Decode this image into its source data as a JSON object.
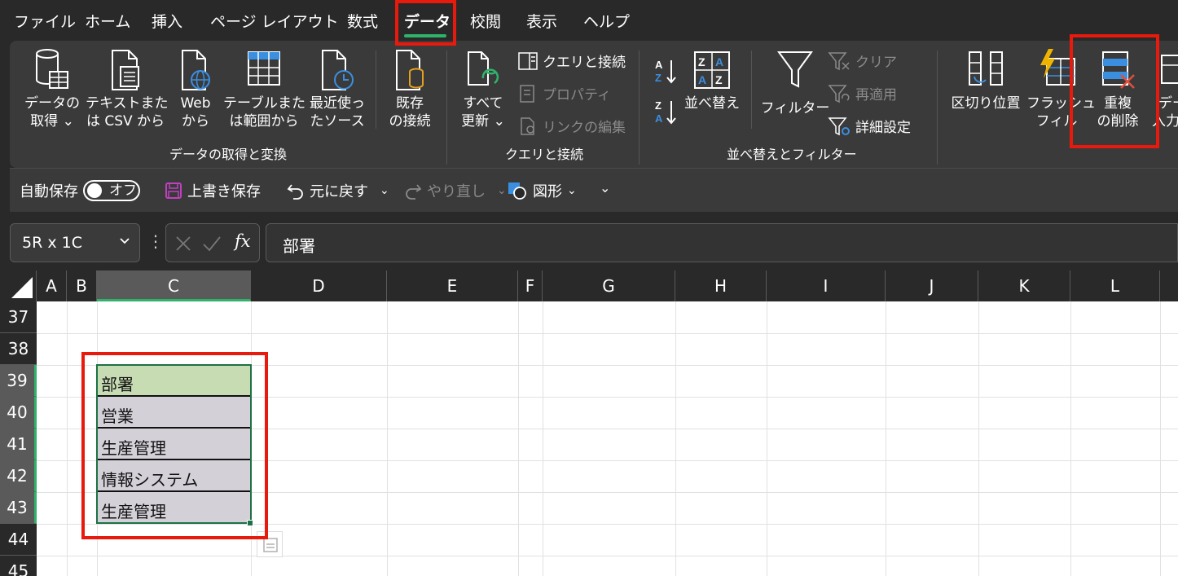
{
  "menu": {
    "tabs": [
      "ファイル",
      "ホーム",
      "挿入",
      "ページ レイアウト",
      "数式",
      "データ",
      "校閲",
      "表示",
      "ヘルプ"
    ],
    "active": "データ"
  },
  "ribbon": {
    "get_data": {
      "line1": "データの",
      "line2": "取得 ⌄"
    },
    "from_text": {
      "line1": "テキストまた",
      "line2": "は CSV から"
    },
    "from_web": {
      "line1": "Web",
      "line2": "から"
    },
    "from_table": {
      "line1": "テーブルまた",
      "line2": "は範囲から"
    },
    "recent_sources": {
      "line1": "最近使っ",
      "line2": "たソース"
    },
    "existing_connections": {
      "line1": "既存",
      "line2": "の接続"
    },
    "group1_label": "データの取得と変換",
    "refresh_all": {
      "line1": "すべて",
      "line2": "更新 ⌄"
    },
    "queries_connections": "クエリと接続",
    "properties": "プロパティ",
    "edit_links": "リンクの編集",
    "group2_label": "クエリと接続",
    "sort": "並べ替え",
    "filter": "フィルター",
    "clear": "クリア",
    "reapply": "再適用",
    "advanced": "詳細設定",
    "group3_label": "並べ替えとフィルター",
    "text_to_columns": "区切り位置",
    "flash_fill": {
      "line1": "フラッシュ",
      "line2": "フィル"
    },
    "remove_duplicates": {
      "line1": "重複",
      "line2": "の削除"
    },
    "data_validation": {
      "line1": "デー",
      "line2": "入力"
    }
  },
  "qat": {
    "autosave": "自動保存",
    "autosave_state": "オフ",
    "save": "上書き保存",
    "undo": "元に戻す",
    "redo": "やり直し",
    "shapes": "図形"
  },
  "formula_bar": {
    "name_box": "5R x 1C",
    "fx": "fx",
    "content": "部署"
  },
  "columns": [
    "A",
    "B",
    "C",
    "D",
    "E",
    "F",
    "G",
    "H",
    "I",
    "J",
    "K",
    "L"
  ],
  "rows": [
    "37",
    "38",
    "39",
    "40",
    "41",
    "42",
    "43",
    "44",
    "45"
  ],
  "cells": [
    "部署",
    "営業",
    "生産管理",
    "情報システム",
    "生産管理"
  ],
  "colors": {
    "accent_green": "#2fb36a",
    "highlight_red": "#e8190d",
    "header_cell_fill": "#c8dcb4",
    "selection_fill": "#d4d0d8"
  }
}
